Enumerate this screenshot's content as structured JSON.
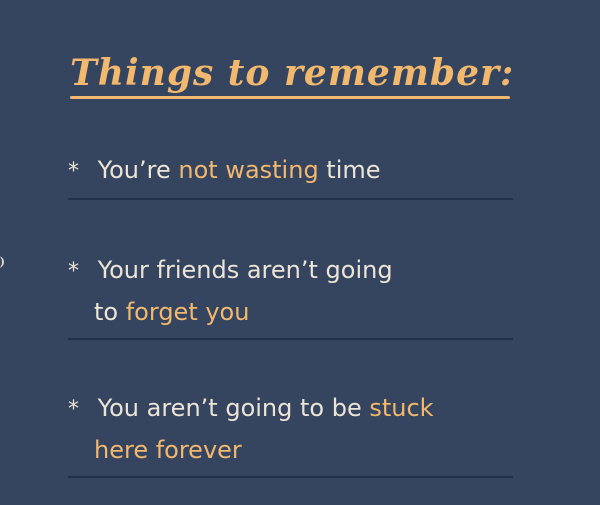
{
  "title": "Things to remember:",
  "items": [
    {
      "bullet": "*",
      "lines": [
        [
          {
            "t": "You’re ",
            "a": false
          },
          {
            "t": "not wasting",
            "a": true
          },
          {
            "t": " time",
            "a": false
          }
        ]
      ]
    },
    {
      "bullet": "*",
      "lines": [
        [
          {
            "t": "Your friends aren’t going",
            "a": false
          }
        ],
        [
          {
            "t": "to ",
            "a": false
          },
          {
            "t": "forget you",
            "a": true
          }
        ]
      ]
    },
    {
      "bullet": "*",
      "lines": [
        [
          {
            "t": "You aren’t going to be ",
            "a": false
          },
          {
            "t": "stuck",
            "a": true
          }
        ],
        [
          {
            "t": "here forever",
            "a": true
          }
        ]
      ]
    }
  ],
  "colors": {
    "background": "#354560",
    "accent": "#f1b86e",
    "text": "#ece4d6",
    "rule": "#233049"
  }
}
